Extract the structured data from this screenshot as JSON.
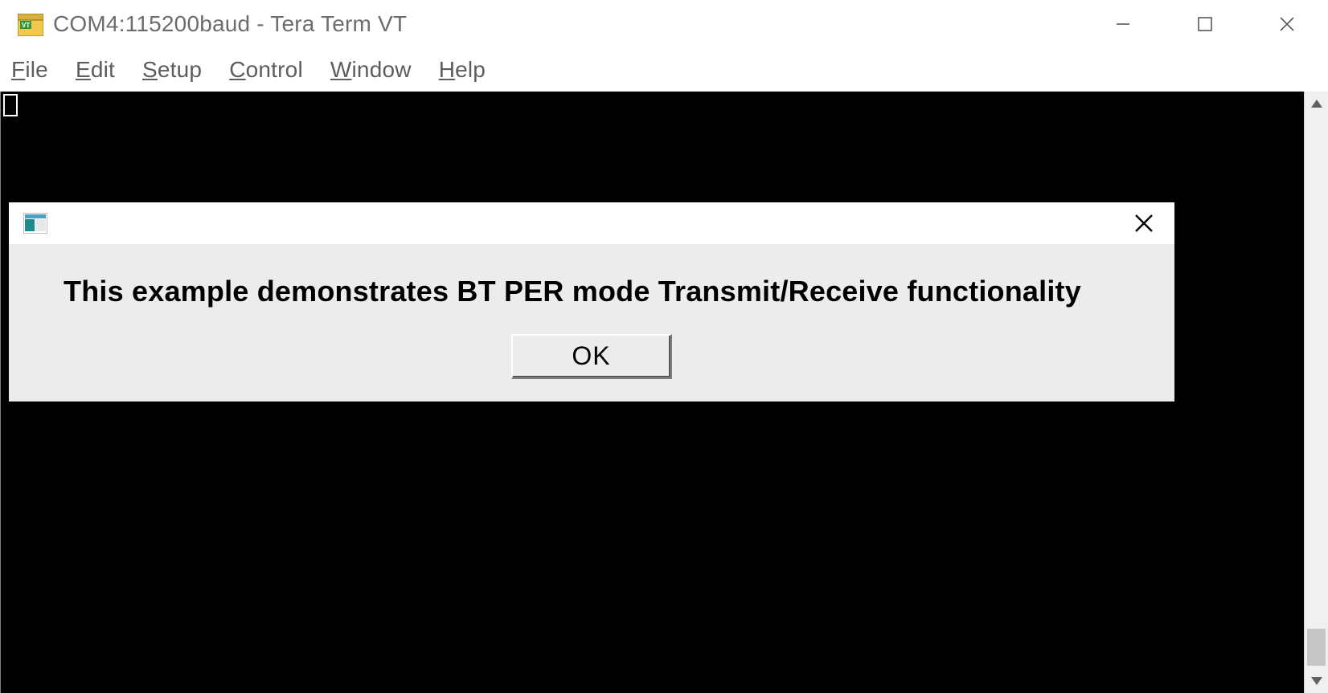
{
  "window": {
    "title": "COM4:115200baud - Tera Term VT"
  },
  "menubar": {
    "items": [
      {
        "label": "File",
        "accel_index": 0
      },
      {
        "label": "Edit",
        "accel_index": 0
      },
      {
        "label": "Setup",
        "accel_index": 0
      },
      {
        "label": "Control",
        "accel_index": 0
      },
      {
        "label": "Window",
        "accel_index": 0
      },
      {
        "label": "Help",
        "accel_index": 0
      }
    ]
  },
  "dialog": {
    "message": "This example demonstrates BT PER mode Transmit/Receive functionality",
    "ok_label": "OK"
  }
}
